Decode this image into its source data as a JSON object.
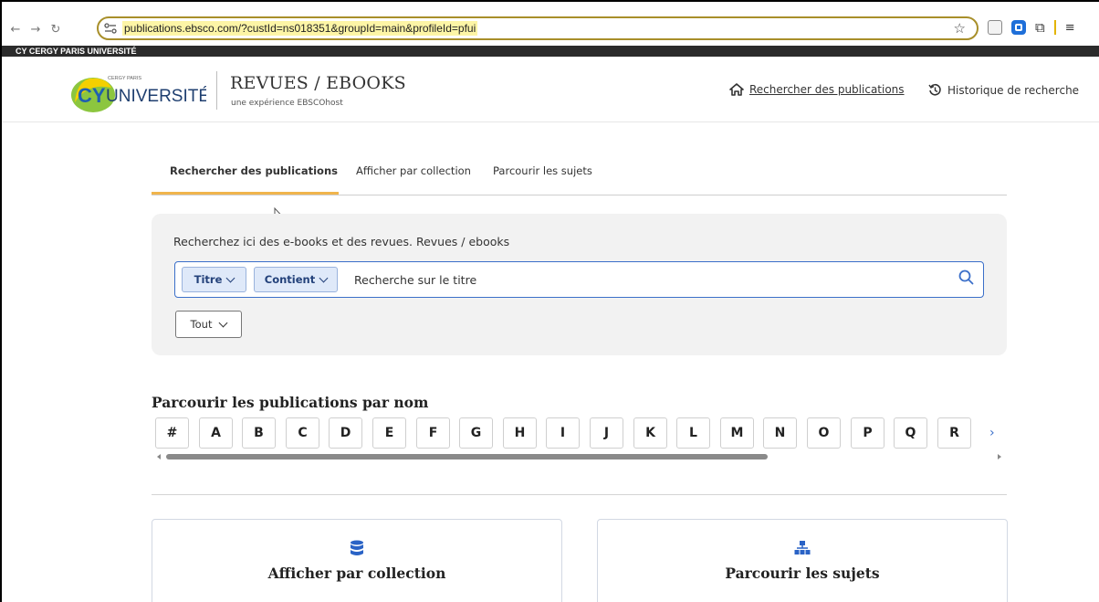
{
  "browser": {
    "url": "publications.ebsco.com/?custId=ns018351&groupId=main&profileId=pfui",
    "nav_icons": [
      "back-arrow-icon",
      "forward-arrow-icon",
      "reload-icon"
    ],
    "toolbar_icons": [
      "bookmark-star-icon",
      "reader-icon",
      "extension-icon",
      "puzzle-icon",
      "menu-icon"
    ]
  },
  "university_bar": {
    "label": "CY CERGY PARIS UNIVERSITÉ"
  },
  "header": {
    "logo_small": "CERGY PARIS",
    "logo_text": "UNIVERSITÉ",
    "logo_mark": "CY",
    "title": "REVUES / EBOOKS",
    "subtitle": "une expérience EBSCOhost",
    "links": [
      {
        "label": "Rechercher des publications",
        "icon": "home-icon"
      },
      {
        "label": "Historique de recherche",
        "icon": "history-icon"
      }
    ]
  },
  "tabs": [
    {
      "label": "Rechercher des publications",
      "active": true
    },
    {
      "label": "Afficher par collection",
      "active": false
    },
    {
      "label": "Parcourir les sujets",
      "active": false
    }
  ],
  "search": {
    "hint": "Recherchez ici des e-books et des revues. Revues / ebooks",
    "field_dropdown": "Titre",
    "operator_dropdown": "Contient",
    "placeholder": "Recherche sur le titre",
    "scope_dropdown": "Tout",
    "accent": "#3b6fc9"
  },
  "browse": {
    "title": "Parcourir les publications par nom",
    "letters": [
      "#",
      "A",
      "B",
      "C",
      "D",
      "E",
      "F",
      "G",
      "H",
      "I",
      "J",
      "K",
      "L",
      "M",
      "N",
      "O",
      "P",
      "Q",
      "R"
    ],
    "more_icon": "chevron-right-icon"
  },
  "cards": [
    {
      "title": "Afficher par collection",
      "icon": "database-icon"
    },
    {
      "title": "Parcourir les sujets",
      "icon": "hierarchy-icon"
    }
  ],
  "colors": {
    "tab_active": "#f0b44c",
    "logo_green": "#8cc63f",
    "logo_yellow": "#f4d000",
    "icon_blue": "#2a63c6"
  }
}
